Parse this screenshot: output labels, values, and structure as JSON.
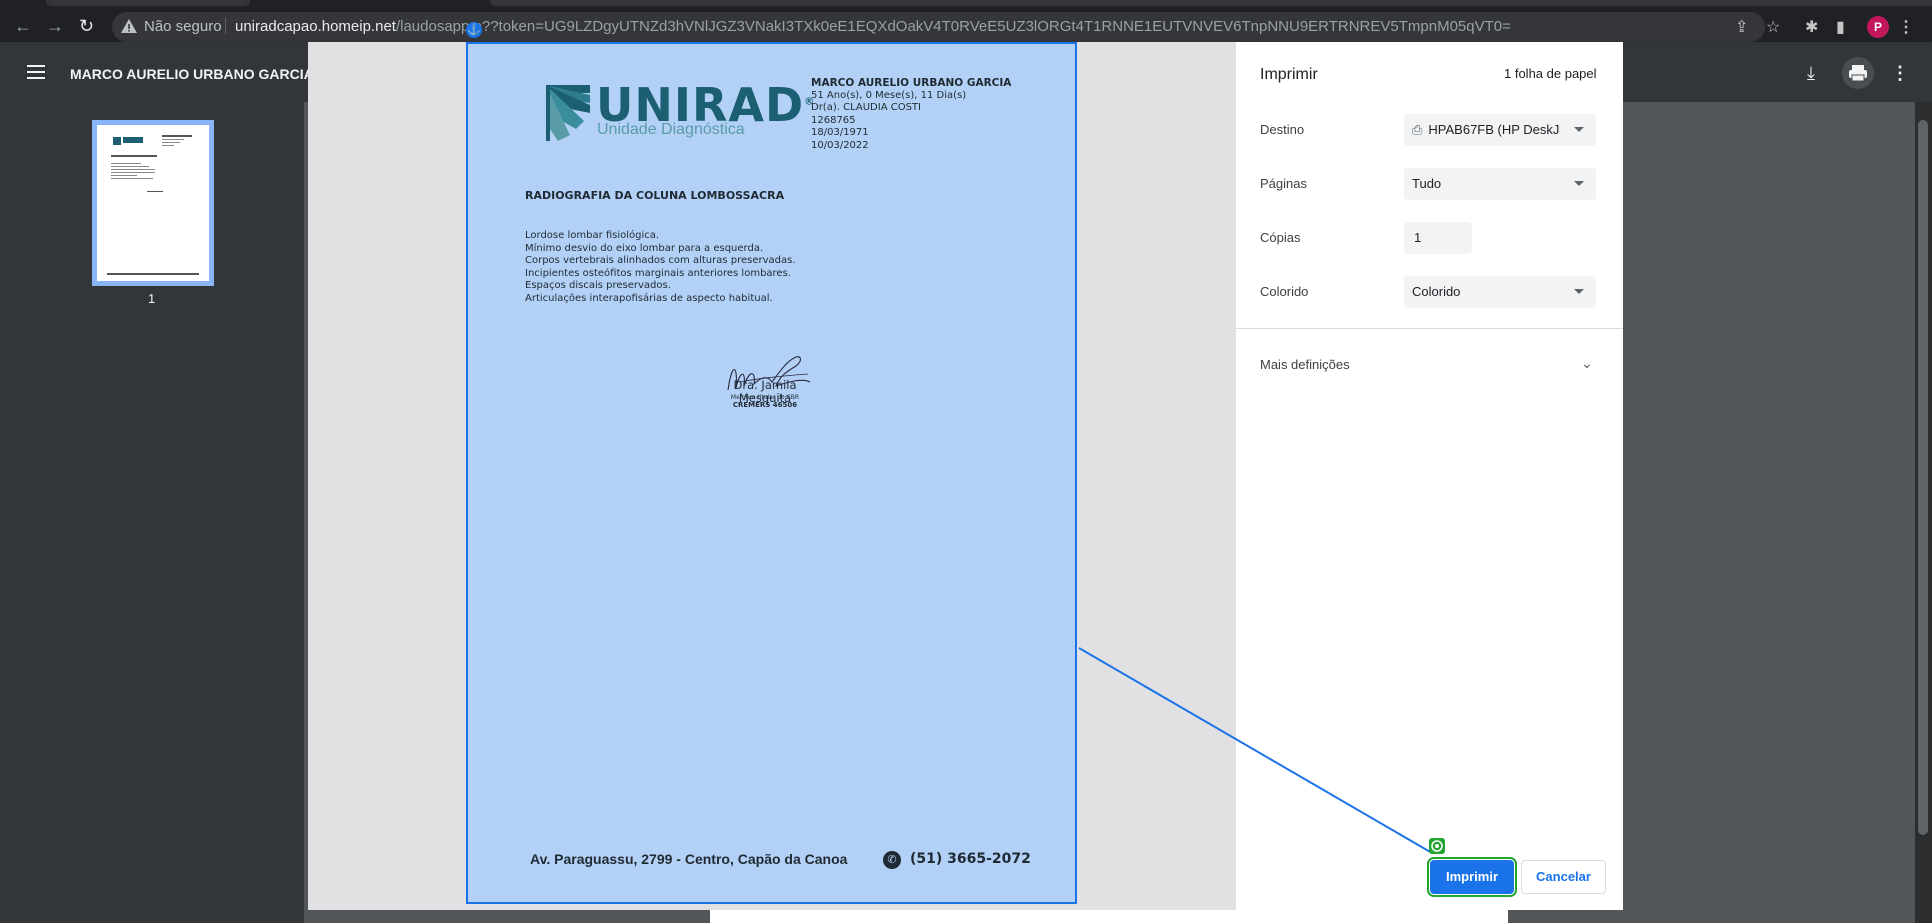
{
  "browser": {
    "security_label": "Não seguro",
    "url_host": "uniradcapao.homeip.net",
    "url_rest": "/laudosapp.p??token=UG9LZDgyUTNZd3hVNlJGZ3VNakI3TXk0eE1EQXdOakV4T0RVeE5UZ3lORGt4T1RNNE1EUTVNVEV6TnpNNU9ERTRNREV5TmpnM05qVT0=",
    "avatar_letter": "P"
  },
  "viewer": {
    "document_title": "MARCO AURELIO URBANO GARCIA",
    "thumbnail_page": "1"
  },
  "report": {
    "logo_word": "UNIRAD",
    "logo_registered": "®",
    "logo_subtitle": "Unidade Diagnóstica",
    "patient_name": "MARCO AURELIO URBANO GARCIA",
    "patient_age": "51 Ano(s), 0 Mese(s), 11 Dia(s)",
    "doctor": "Dr(a). CLAUDIA COSTI",
    "record_number": "1268765",
    "birth_date": "18/03/1971",
    "exam_date": "10/03/2022",
    "exam_title": "RADIOGRAFIA DA COLUNA LOMBOSSACRA",
    "findings": [
      "Lordose lombar fisiológica.",
      "Mínimo desvio do eixo lombar para a esquerda.",
      "Corpos vertebrais alinhados com alturas preservadas.",
      "Incipientes osteófitos marginais anteriores lombares.",
      "Espaços discais preservados.",
      "Articulações interapofisárias de aspecto habitual."
    ],
    "signature_name": "Dra. Jamila Mesquita",
    "signature_role": "Membro titular do CBR",
    "signature_crm": "CREMERS 46506",
    "footer_address": "Av. Paraguassu, 2799 - Centro, Capão da Canoa",
    "footer_phone": "(51) 3665-2072"
  },
  "print_panel": {
    "title": "Imprimir",
    "sheet_count": "1 folha de papel",
    "destination_label": "Destino",
    "destination_value": "HPAB67FB (HP DeskJ",
    "pages_label": "Páginas",
    "pages_value": "Tudo",
    "copies_label": "Cópias",
    "copies_value": "1",
    "color_label": "Colorido",
    "color_value": "Colorido",
    "more_settings": "Mais definições",
    "print_button": "Imprimir",
    "cancel_button": "Cancelar"
  },
  "colors": {
    "accent": "#1a73e8",
    "paper_highlight": "#b3d1f6",
    "marker": "#23a532",
    "logo": "#1c5f72"
  }
}
